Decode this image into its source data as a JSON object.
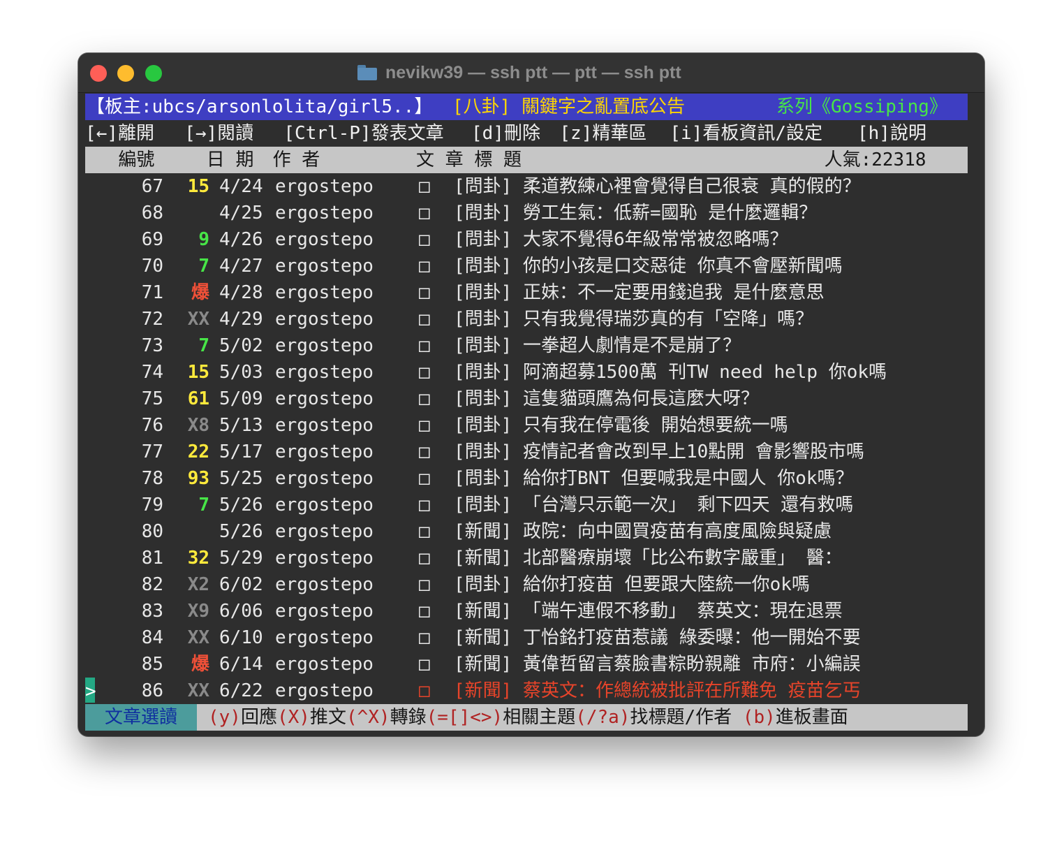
{
  "window": {
    "title": "nevikw39 — ssh ptt — ptt — ssh ptt"
  },
  "header": {
    "moderators": "【板主:ubcs/arsonlolita/girl5..】",
    "announcement": "[八卦] 關鍵字之亂置底公告",
    "series": "系列《Gossiping》"
  },
  "menu": [
    {
      "label": "[←]離開",
      "col": 0
    },
    {
      "label": "[→]閱讀",
      "col": 9
    },
    {
      "label": "[Ctrl-P]發表文章",
      "col": 18
    },
    {
      "label": "[d]刪除",
      "col": 35
    },
    {
      "label": "[z]精華區",
      "col": 43
    },
    {
      "label": "[i]看板資訊/設定",
      "col": 53
    },
    {
      "label": "[h]說明",
      "col": 70
    }
  ],
  "columns": [
    {
      "label": "編號",
      "col": 3
    },
    {
      "label": "日 期",
      "col": 11
    },
    {
      "label": "作  者",
      "col": 17
    },
    {
      "label": "文  章  標  題",
      "col": 30
    },
    {
      "label": "人氣:22318",
      "col": 67
    }
  ],
  "posts": [
    {
      "num": "67",
      "score": "15",
      "score_color": "#ffea3c",
      "date": "4/24",
      "author": "ergostepo",
      "mark": "□",
      "title": "[問卦] 柔道教練心裡會覺得自己很衰 真的假的？"
    },
    {
      "num": "68",
      "score": "",
      "score_color": "#e8e8e8",
      "date": "4/25",
      "author": "ergostepo",
      "mark": "□",
      "title": "[問卦] 勞工生氣：低薪=國恥   是什麼邏輯？"
    },
    {
      "num": "69",
      "score": "9",
      "score_color": "#47e547",
      "date": "4/26",
      "author": "ergostepo",
      "mark": "□",
      "title": "[問卦] 大家不覺得6年級常常被忽略嗎？"
    },
    {
      "num": "70",
      "score": "7",
      "score_color": "#47e547",
      "date": "4/27",
      "author": "ergostepo",
      "mark": "□",
      "title": "[問卦] 你的小孩是口交惡徒  你真不會壓新聞嗎"
    },
    {
      "num": "71",
      "score": "爆",
      "score_color": "#f05038",
      "date": "4/28",
      "author": "ergostepo",
      "mark": "□",
      "title": "[問卦] 正妹：不一定要用錢追我   是什麼意思"
    },
    {
      "num": "72",
      "score": "XX",
      "score_color": "#8a8a8a",
      "date": "4/29",
      "author": "ergostepo",
      "mark": "□",
      "title": "[問卦] 只有我覺得瑞莎真的有「空降」嗎？"
    },
    {
      "num": "73",
      "score": "7",
      "score_color": "#47e547",
      "date": "5/02",
      "author": "ergostepo",
      "mark": "□",
      "title": "[問卦] 一拳超人劇情是不是崩了？"
    },
    {
      "num": "74",
      "score": "15",
      "score_color": "#ffea3c",
      "date": "5/03",
      "author": "ergostepo",
      "mark": "□",
      "title": "[問卦] 阿滴超募1500萬 刊TW need help  你ok嗎"
    },
    {
      "num": "75",
      "score": "61",
      "score_color": "#ffea3c",
      "date": "5/09",
      "author": "ergostepo",
      "mark": "□",
      "title": "[問卦] 這隻貓頭鷹為何長這麼大呀？"
    },
    {
      "num": "76",
      "score": "X8",
      "score_color": "#8a8a8a",
      "date": "5/13",
      "author": "ergostepo",
      "mark": "□",
      "title": "[問卦] 只有我在停電後 開始想要統一嗎"
    },
    {
      "num": "77",
      "score": "22",
      "score_color": "#ffea3c",
      "date": "5/17",
      "author": "ergostepo",
      "mark": "□",
      "title": "[問卦] 疫情記者會改到早上10點開 會影響股市嗎"
    },
    {
      "num": "78",
      "score": "93",
      "score_color": "#ffea3c",
      "date": "5/25",
      "author": "ergostepo",
      "mark": "□",
      "title": "[問卦] 給你打BNT 但要喊我是中國人 你ok嗎？"
    },
    {
      "num": "79",
      "score": "7",
      "score_color": "#47e547",
      "date": "5/26",
      "author": "ergostepo",
      "mark": "□",
      "title": "[問卦] 「台灣只示範一次」 剩下四天 還有救嗎"
    },
    {
      "num": "80",
      "score": "",
      "score_color": "#e8e8e8",
      "date": "5/26",
      "author": "ergostepo",
      "mark": "□",
      "title": "[新聞] 政院：向中國買疫苗有高度風險與疑慮"
    },
    {
      "num": "81",
      "score": "32",
      "score_color": "#ffea3c",
      "date": "5/29",
      "author": "ergostepo",
      "mark": "□",
      "title": "[新聞] 北部醫療崩壞「比公布數字嚴重」 醫："
    },
    {
      "num": "82",
      "score": "X2",
      "score_color": "#8a8a8a",
      "date": "6/02",
      "author": "ergostepo",
      "mark": "□",
      "title": "[問卦] 給你打疫苗  但要跟大陸統一你ok嗎"
    },
    {
      "num": "83",
      "score": "X9",
      "score_color": "#8a8a8a",
      "date": "6/06",
      "author": "ergostepo",
      "mark": "□",
      "title": "[新聞] 「端午連假不移動」 蔡英文：現在退票"
    },
    {
      "num": "84",
      "score": "XX",
      "score_color": "#8a8a8a",
      "date": "6/10",
      "author": "ergostepo",
      "mark": "□",
      "title": "[新聞] 丁怡銘打疫苗惹議 綠委曝：他一開始不要"
    },
    {
      "num": "85",
      "score": "爆",
      "score_color": "#f05038",
      "date": "6/14",
      "author": "ergostepo",
      "mark": "□",
      "title": "[新聞] 黃偉哲留言蔡臉書粽盼親離 市府：小編誤"
    },
    {
      "num": "86",
      "score": "XX",
      "score_color": "#8a8a8a",
      "date": "6/22",
      "author": "ergostepo",
      "mark": "□",
      "title": "[新聞] 蔡英文：作總統被批評在所難免 疫苗乞丐",
      "selected": true,
      "cursor": ">"
    }
  ],
  "footer": {
    "label": "文章選讀",
    "help": [
      {
        "key": "(y)",
        "text": "回應"
      },
      {
        "key": "(X)",
        "text": "推文"
      },
      {
        "key": "(^X)",
        "text": "轉錄"
      },
      {
        "key": "(=[]<>)",
        "text": "相關主題"
      },
      {
        "key": "(/?a)",
        "text": "找標題/作者"
      },
      {
        "key": " (b)",
        "text": "進板畫面"
      }
    ]
  }
}
